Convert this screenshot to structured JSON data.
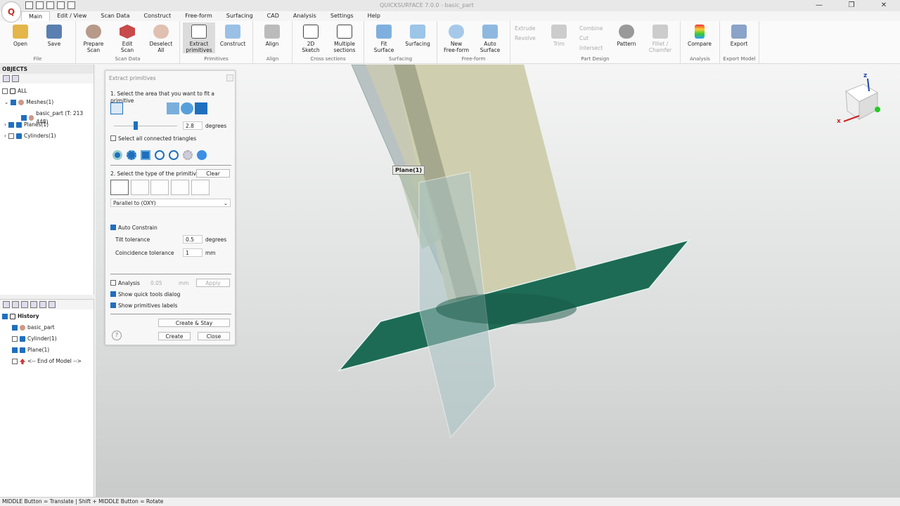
{
  "window": {
    "title": "QUICKSURFACE 7.0.0 - basic_part"
  },
  "menu": {
    "tabs": [
      "Main",
      "Edit / View",
      "Scan Data",
      "Construct",
      "Free-form",
      "Surfacing",
      "CAD",
      "Analysis",
      "Settings",
      "Help"
    ]
  },
  "ribbon": {
    "file": {
      "label": "File",
      "open": "Open",
      "save": "Save"
    },
    "scan": {
      "label": "Scan Data",
      "prepare": "Prepare\nScan",
      "edit": "Edit\nScan",
      "deselect": "Deselect\nAll"
    },
    "primitives": {
      "label": "Primitives",
      "extract": "Extract\nprimitives",
      "construct": "Construct"
    },
    "align": {
      "label": "Align",
      "align": "Align"
    },
    "cross": {
      "label": "Cross sections",
      "sketch": "2D\nSketch",
      "multiple": "Multiple\nsections"
    },
    "surfacing": {
      "label": "Surfacing",
      "fit": "Fit\nSurface",
      "surfacing": "Surfacing"
    },
    "freeform": {
      "label": "Free-form",
      "new": "New\nFree-form",
      "auto": "Auto\nSurface"
    },
    "part": {
      "label": "Part Design",
      "extrude": "Extrude",
      "revolve": "Revolve",
      "trim": "Trim",
      "combine": "Combine",
      "cut": "Cut",
      "intersect": "Intersect",
      "pattern": "Pattern",
      "fillet": "Fillet /\nChamfer"
    },
    "analysis": {
      "label": "Analysis",
      "compare": "Compare"
    },
    "export": {
      "label": "Export Model",
      "export": "Export"
    }
  },
  "objects": {
    "title": "OBJECTS",
    "all": "ALL",
    "meshes": "Meshes(1)",
    "basic_part": "basic_part (T: 213 448)",
    "planes": "Planes(1)",
    "cylinders": "Cylinders(1)"
  },
  "history": {
    "title": "History",
    "items": [
      "basic_part",
      "Cylinder(1)",
      "Plane(1)",
      "<-- End of Model -->"
    ]
  },
  "dialog": {
    "title": "Extract primitives",
    "step1": "1. Select the area that you want to fit a primitive",
    "angle_value": "2.8",
    "angle_unit": "degrees",
    "select_connected": "Select all connected triangles",
    "step2": "2. Select the type of the primitive",
    "clear": "Clear",
    "constraint": "Parallel to (OXY)",
    "auto_constrain": "Auto Constrain",
    "tilt_label": "Tilt tolerance",
    "tilt_value": "0.5",
    "tilt_unit": "degrees",
    "coincidence_label": "Coincidence tolerance",
    "coincidence_value": "1",
    "coincidence_unit": "mm",
    "analysis": "Analysis",
    "analysis_value": "0.05",
    "analysis_unit": "mm",
    "apply": "Apply",
    "show_quick": "Show quick tools dialog",
    "show_labels": "Show primitives labels",
    "create_stay": "Create & Stay",
    "create": "Create",
    "close": "Close"
  },
  "viewport": {
    "plane_label": "Plane(1)",
    "axis_x": "x",
    "axis_z": "z"
  },
  "status": {
    "text": "MIDDLE Button = Translate | Shift + MIDDLE Button = Rotate"
  },
  "colors": {
    "plane": "#1d6b55",
    "cylinder": "#cfcfb0",
    "accent": "#1f6fbf"
  }
}
